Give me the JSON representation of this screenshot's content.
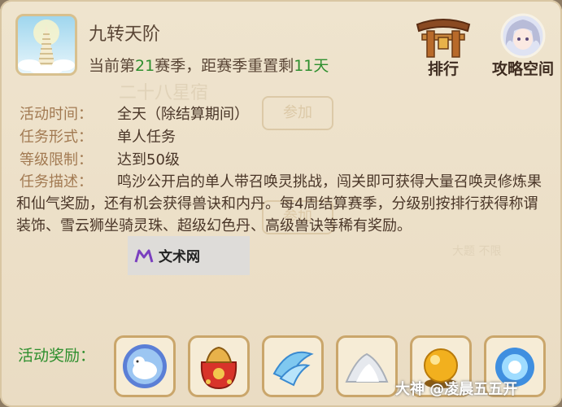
{
  "activity": {
    "title": "九转天阶",
    "season_prefix": "当前第",
    "season_number": "21",
    "season_mid": "赛季，距赛季重置剩",
    "days_left": "11天"
  },
  "top_buttons": {
    "ranking_label": "排行",
    "guide_label": "攻略空间"
  },
  "background_ghost": {
    "star_name": "二十八星宿",
    "join_label": "参加",
    "join_label_2": "参加",
    "limit_text": "大题 不限"
  },
  "info_rows": [
    {
      "key": "活动时间：",
      "value": "全天（除结算期间）"
    },
    {
      "key": "任务形式：",
      "value": "单人任务"
    },
    {
      "key": "等级限制：",
      "value": "达到50级"
    }
  ],
  "description": {
    "key": "任务描述：",
    "text": "鸣沙公开启的单人带召唤灵挑战，闯关即可获得大量召唤灵修炼果和仙气奖励，还有机会获得兽诀和内丹。每4周结算赛季，分级别按排行获得称谓装饰、雪云狮坐骑灵珠、超级幻色丹、高级兽诀等稀有奖励。"
  },
  "watermark": {
    "text": "文术网"
  },
  "rewards": {
    "label": "活动奖励：",
    "items": [
      {
        "icon": "snow-lion-orb-icon"
      },
      {
        "icon": "red-gift-bag-icon"
      },
      {
        "icon": "blue-scale-icon"
      },
      {
        "icon": "silver-powder-icon"
      },
      {
        "icon": "golden-pill-icon"
      },
      {
        "icon": "blue-spirit-icon"
      }
    ]
  },
  "footer_watermark": "大神 @凌晨五五开",
  "colors": {
    "label_brown": "#a27a52",
    "text_dark": "#4a3628",
    "highlight_green": "#2e8f2e",
    "panel_bg": "#efe4ce"
  }
}
